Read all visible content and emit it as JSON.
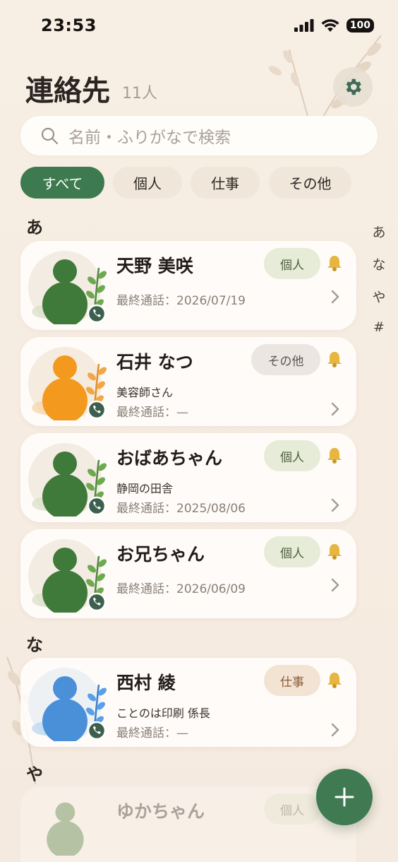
{
  "status_bar": {
    "time": "23:53",
    "battery": "100"
  },
  "header": {
    "title": "連絡先",
    "count": "11人"
  },
  "search": {
    "placeholder": "名前・ふりがなで検索"
  },
  "filters": [
    "すべて",
    "個人",
    "仕事",
    "その他"
  ],
  "index": [
    "あ",
    "な",
    "や",
    "#"
  ],
  "sections": [
    {
      "letter": "あ",
      "contacts": [
        {
          "name": "天野 美咲",
          "tag": "個人",
          "note": "",
          "last_call": "最終通話：2026/07/19",
          "color": "#3f7a3a"
        },
        {
          "name": "石井 なつ",
          "tag": "その他",
          "note": "美容師さん",
          "last_call": "最終通話：—",
          "color": "#f39a1e"
        },
        {
          "name": "おばあちゃん",
          "tag": "個人",
          "note": "静岡の田舎",
          "last_call": "最終通話：2025/08/06",
          "color": "#3f7a3a"
        },
        {
          "name": "お兄ちゃん",
          "tag": "個人",
          "note": "",
          "last_call": "最終通話：2026/06/09",
          "color": "#3f7a3a"
        }
      ]
    },
    {
      "letter": "な",
      "contacts": [
        {
          "name": "西村 綾",
          "tag": "仕事",
          "note": "ことのは印刷 係長",
          "last_call": "最終通話：—",
          "color": "#4a90d9"
        }
      ]
    },
    {
      "letter": "や",
      "contacts": [
        {
          "name": "ゆかちゃん",
          "tag": "個人",
          "note": "",
          "last_call": "",
          "color": "#3f7a3a"
        }
      ]
    }
  ],
  "colors": {
    "accent": "#3e7a4f",
    "background": "#f7eee4"
  }
}
